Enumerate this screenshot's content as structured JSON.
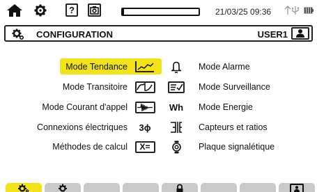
{
  "status_bar": {
    "datetime": "21/03/25 09:36",
    "progress_fraction": 0.02
  },
  "title_bar": {
    "title": "CONFIGURATION",
    "user": "USER1"
  },
  "menu": {
    "left": [
      {
        "label": "Mode Tendance",
        "icon": "trend-icon",
        "selected": true
      },
      {
        "label": "Mode Transitoire",
        "icon": "transient-icon"
      },
      {
        "label": "Mode Courant d'appel",
        "icon": "inrush-icon"
      },
      {
        "label": "Connexions électriques",
        "icon": "three-phase-icon",
        "icon_text": "3ϕ"
      },
      {
        "label": "Méthodes de calcul",
        "icon": "calculation-icon",
        "icon_text": "X="
      }
    ],
    "right": [
      {
        "label": "Mode Alarme",
        "icon": "bell-icon"
      },
      {
        "label": "Mode Surveillance",
        "icon": "monitoring-icon"
      },
      {
        "label": "Mode Energie",
        "icon": "energy-icon",
        "icon_text": "Wh"
      },
      {
        "label": "Capteurs et ratios",
        "icon": "sensors-icon"
      },
      {
        "label": "Plaque signalétique",
        "icon": "nameplate-icon"
      }
    ]
  },
  "tabs": [
    {
      "icon": "configuration-gear-icon",
      "active": true
    },
    {
      "icon": "gear-icon",
      "active": false
    },
    {
      "icon": "empty",
      "active": false
    },
    {
      "icon": "empty",
      "active": false
    },
    {
      "icon": "lock-icon",
      "active": false
    },
    {
      "icon": "empty",
      "active": false
    },
    {
      "icon": "empty",
      "active": false
    },
    {
      "icon": "user-icon",
      "active": false
    }
  ],
  "colors": {
    "accent": "#f2e21a",
    "tab_inactive": "#c9c9c9",
    "text": "#111111"
  }
}
